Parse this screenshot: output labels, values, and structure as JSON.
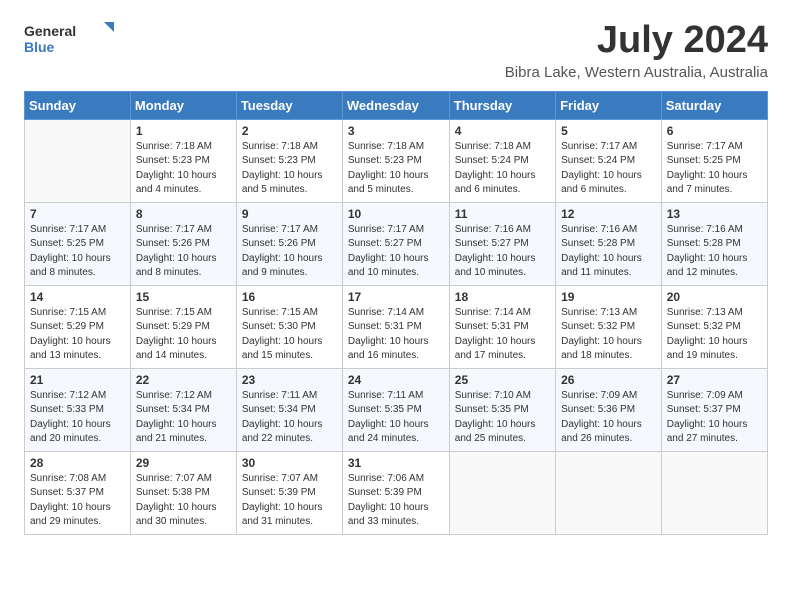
{
  "logo": {
    "general": "General",
    "blue": "Blue"
  },
  "title": "July 2024",
  "subtitle": "Bibra Lake, Western Australia, Australia",
  "days_header": [
    "Sunday",
    "Monday",
    "Tuesday",
    "Wednesday",
    "Thursday",
    "Friday",
    "Saturday"
  ],
  "weeks": [
    [
      {
        "day": "",
        "info": ""
      },
      {
        "day": "1",
        "info": "Sunrise: 7:18 AM\nSunset: 5:23 PM\nDaylight: 10 hours\nand 4 minutes."
      },
      {
        "day": "2",
        "info": "Sunrise: 7:18 AM\nSunset: 5:23 PM\nDaylight: 10 hours\nand 5 minutes."
      },
      {
        "day": "3",
        "info": "Sunrise: 7:18 AM\nSunset: 5:23 PM\nDaylight: 10 hours\nand 5 minutes."
      },
      {
        "day": "4",
        "info": "Sunrise: 7:18 AM\nSunset: 5:24 PM\nDaylight: 10 hours\nand 6 minutes."
      },
      {
        "day": "5",
        "info": "Sunrise: 7:17 AM\nSunset: 5:24 PM\nDaylight: 10 hours\nand 6 minutes."
      },
      {
        "day": "6",
        "info": "Sunrise: 7:17 AM\nSunset: 5:25 PM\nDaylight: 10 hours\nand 7 minutes."
      }
    ],
    [
      {
        "day": "7",
        "info": "Sunrise: 7:17 AM\nSunset: 5:25 PM\nDaylight: 10 hours\nand 8 minutes."
      },
      {
        "day": "8",
        "info": "Sunrise: 7:17 AM\nSunset: 5:26 PM\nDaylight: 10 hours\nand 8 minutes."
      },
      {
        "day": "9",
        "info": "Sunrise: 7:17 AM\nSunset: 5:26 PM\nDaylight: 10 hours\nand 9 minutes."
      },
      {
        "day": "10",
        "info": "Sunrise: 7:17 AM\nSunset: 5:27 PM\nDaylight: 10 hours\nand 10 minutes."
      },
      {
        "day": "11",
        "info": "Sunrise: 7:16 AM\nSunset: 5:27 PM\nDaylight: 10 hours\nand 10 minutes."
      },
      {
        "day": "12",
        "info": "Sunrise: 7:16 AM\nSunset: 5:28 PM\nDaylight: 10 hours\nand 11 minutes."
      },
      {
        "day": "13",
        "info": "Sunrise: 7:16 AM\nSunset: 5:28 PM\nDaylight: 10 hours\nand 12 minutes."
      }
    ],
    [
      {
        "day": "14",
        "info": "Sunrise: 7:15 AM\nSunset: 5:29 PM\nDaylight: 10 hours\nand 13 minutes."
      },
      {
        "day": "15",
        "info": "Sunrise: 7:15 AM\nSunset: 5:29 PM\nDaylight: 10 hours\nand 14 minutes."
      },
      {
        "day": "16",
        "info": "Sunrise: 7:15 AM\nSunset: 5:30 PM\nDaylight: 10 hours\nand 15 minutes."
      },
      {
        "day": "17",
        "info": "Sunrise: 7:14 AM\nSunset: 5:31 PM\nDaylight: 10 hours\nand 16 minutes."
      },
      {
        "day": "18",
        "info": "Sunrise: 7:14 AM\nSunset: 5:31 PM\nDaylight: 10 hours\nand 17 minutes."
      },
      {
        "day": "19",
        "info": "Sunrise: 7:13 AM\nSunset: 5:32 PM\nDaylight: 10 hours\nand 18 minutes."
      },
      {
        "day": "20",
        "info": "Sunrise: 7:13 AM\nSunset: 5:32 PM\nDaylight: 10 hours\nand 19 minutes."
      }
    ],
    [
      {
        "day": "21",
        "info": "Sunrise: 7:12 AM\nSunset: 5:33 PM\nDaylight: 10 hours\nand 20 minutes."
      },
      {
        "day": "22",
        "info": "Sunrise: 7:12 AM\nSunset: 5:34 PM\nDaylight: 10 hours\nand 21 minutes."
      },
      {
        "day": "23",
        "info": "Sunrise: 7:11 AM\nSunset: 5:34 PM\nDaylight: 10 hours\nand 22 minutes."
      },
      {
        "day": "24",
        "info": "Sunrise: 7:11 AM\nSunset: 5:35 PM\nDaylight: 10 hours\nand 24 minutes."
      },
      {
        "day": "25",
        "info": "Sunrise: 7:10 AM\nSunset: 5:35 PM\nDaylight: 10 hours\nand 25 minutes."
      },
      {
        "day": "26",
        "info": "Sunrise: 7:09 AM\nSunset: 5:36 PM\nDaylight: 10 hours\nand 26 minutes."
      },
      {
        "day": "27",
        "info": "Sunrise: 7:09 AM\nSunset: 5:37 PM\nDaylight: 10 hours\nand 27 minutes."
      }
    ],
    [
      {
        "day": "28",
        "info": "Sunrise: 7:08 AM\nSunset: 5:37 PM\nDaylight: 10 hours\nand 29 minutes."
      },
      {
        "day": "29",
        "info": "Sunrise: 7:07 AM\nSunset: 5:38 PM\nDaylight: 10 hours\nand 30 minutes."
      },
      {
        "day": "30",
        "info": "Sunrise: 7:07 AM\nSunset: 5:39 PM\nDaylight: 10 hours\nand 31 minutes."
      },
      {
        "day": "31",
        "info": "Sunrise: 7:06 AM\nSunset: 5:39 PM\nDaylight: 10 hours\nand 33 minutes."
      },
      {
        "day": "",
        "info": ""
      },
      {
        "day": "",
        "info": ""
      },
      {
        "day": "",
        "info": ""
      }
    ]
  ]
}
